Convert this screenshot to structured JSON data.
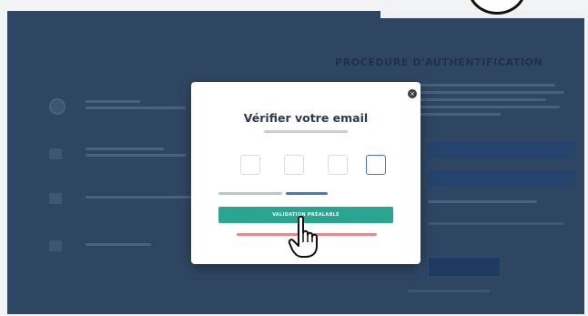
{
  "background_page": {
    "section_title": "PROCEDURE D'AUTHENTIFICATION"
  },
  "modal": {
    "title": "Vérifier votre email",
    "close_icon": "×",
    "code_digits": [
      "",
      "",
      "",
      ""
    ],
    "verify_button_label": "VALIDATION PRÉALABLE"
  },
  "colors": {
    "screen_bg": "#2f4663",
    "accent_green": "#2aa58f",
    "link_blue": "#4a74c9",
    "error_red": "#e58a8a"
  },
  "icons": {
    "close": "close-icon",
    "cursor": "hand-cursor-icon"
  }
}
